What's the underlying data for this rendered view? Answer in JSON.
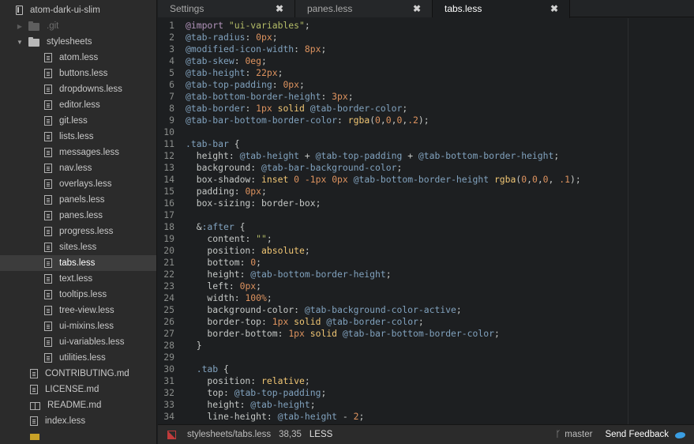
{
  "tree": {
    "root": "atom-dark-ui-slim",
    "git_folder": ".git",
    "stylesheets_folder": "stylesheets",
    "stylesheet_files": [
      "atom.less",
      "buttons.less",
      "dropdowns.less",
      "editor.less",
      "git.less",
      "lists.less",
      "messages.less",
      "nav.less",
      "overlays.less",
      "panels.less",
      "panes.less",
      "progress.less",
      "sites.less",
      "tabs.less",
      "text.less",
      "tooltips.less",
      "tree-view.less",
      "ui-mixins.less",
      "ui-variables.less",
      "utilities.less"
    ],
    "selected_file": "tabs.less",
    "root_files": [
      {
        "name": "CONTRIBUTING.md",
        "icon": "file-icon"
      },
      {
        "name": "LICENSE.md",
        "icon": "file-icon"
      },
      {
        "name": "README.md",
        "icon": "book-icon"
      },
      {
        "name": "index.less",
        "icon": "file-icon"
      }
    ]
  },
  "tabs": [
    {
      "label": "Settings",
      "active": false
    },
    {
      "label": "panes.less",
      "active": false
    },
    {
      "label": "tabs.less",
      "active": true
    }
  ],
  "tab_close_glyph": "✖",
  "editor": {
    "lines": [
      [
        [
          "kw",
          "@import "
        ],
        [
          "str",
          "\"ui-variables\""
        ],
        [
          "punc",
          ";"
        ]
      ],
      [
        [
          "var",
          "@tab-radius"
        ],
        [
          "punc",
          ": "
        ],
        [
          "num",
          "0px"
        ],
        [
          "punc",
          ";"
        ]
      ],
      [
        [
          "var",
          "@modified-icon-width"
        ],
        [
          "punc",
          ": "
        ],
        [
          "num",
          "8px"
        ],
        [
          "punc",
          ";"
        ]
      ],
      [
        [
          "var",
          "@tab-skew"
        ],
        [
          "punc",
          ": "
        ],
        [
          "num",
          "0eg"
        ],
        [
          "punc",
          ";"
        ]
      ],
      [
        [
          "var",
          "@tab-height"
        ],
        [
          "punc",
          ": "
        ],
        [
          "num",
          "22px"
        ],
        [
          "punc",
          ";"
        ]
      ],
      [
        [
          "var",
          "@tab-top-padding"
        ],
        [
          "punc",
          ": "
        ],
        [
          "num",
          "0px"
        ],
        [
          "punc",
          ";"
        ]
      ],
      [
        [
          "var",
          "@tab-bottom-border-height"
        ],
        [
          "punc",
          ": "
        ],
        [
          "num",
          "3px"
        ],
        [
          "punc",
          ";"
        ]
      ],
      [
        [
          "var",
          "@tab-border"
        ],
        [
          "punc",
          ": "
        ],
        [
          "num",
          "1px"
        ],
        [
          "punc",
          " "
        ],
        [
          "val",
          "solid"
        ],
        [
          "punc",
          " "
        ],
        [
          "var",
          "@tab-border-color"
        ],
        [
          "punc",
          ";"
        ]
      ],
      [
        [
          "var",
          "@tab-bar-bottom-border-color"
        ],
        [
          "punc",
          ": "
        ],
        [
          "val",
          "rgba"
        ],
        [
          "punc",
          "("
        ],
        [
          "num",
          "0"
        ],
        [
          "punc",
          ","
        ],
        [
          "num",
          "0"
        ],
        [
          "punc",
          ","
        ],
        [
          "num",
          "0"
        ],
        [
          "punc",
          ","
        ],
        [
          "num",
          ".2"
        ],
        [
          "punc",
          ");"
        ]
      ],
      [],
      [
        [
          "sel",
          ".tab-bar"
        ],
        [
          "punc",
          " {"
        ]
      ],
      [
        [
          "prop",
          "  height"
        ],
        [
          "punc",
          ": "
        ],
        [
          "var",
          "@tab-height"
        ],
        [
          "punc",
          " + "
        ],
        [
          "var",
          "@tab-top-padding"
        ],
        [
          "punc",
          " + "
        ],
        [
          "var",
          "@tab-bottom-border-height"
        ],
        [
          "punc",
          ";"
        ]
      ],
      [
        [
          "prop",
          "  background"
        ],
        [
          "punc",
          ": "
        ],
        [
          "var",
          "@tab-bar-background-color"
        ],
        [
          "punc",
          ";"
        ]
      ],
      [
        [
          "prop",
          "  box-shadow"
        ],
        [
          "punc",
          ": "
        ],
        [
          "val",
          "inset"
        ],
        [
          "punc",
          " "
        ],
        [
          "num",
          "0"
        ],
        [
          "punc",
          " "
        ],
        [
          "num",
          "-1px"
        ],
        [
          "punc",
          " "
        ],
        [
          "num",
          "0px"
        ],
        [
          "punc",
          " "
        ],
        [
          "var",
          "@tab-bottom-border-height"
        ],
        [
          "punc",
          " "
        ],
        [
          "val",
          "rgba"
        ],
        [
          "punc",
          "("
        ],
        [
          "num",
          "0"
        ],
        [
          "punc",
          ","
        ],
        [
          "num",
          "0"
        ],
        [
          "punc",
          ","
        ],
        [
          "num",
          "0"
        ],
        [
          "punc",
          ", "
        ],
        [
          "num",
          ".1"
        ],
        [
          "punc",
          ");"
        ]
      ],
      [
        [
          "prop",
          "  padding"
        ],
        [
          "punc",
          ": "
        ],
        [
          "num",
          "0px"
        ],
        [
          "punc",
          ";"
        ]
      ],
      [
        [
          "prop",
          "  box-sizing"
        ],
        [
          "punc",
          ": border-box;"
        ]
      ],
      [],
      [
        [
          "punc",
          "  &"
        ],
        [
          "sel",
          ":after"
        ],
        [
          "punc",
          " {"
        ]
      ],
      [
        [
          "prop",
          "    content"
        ],
        [
          "punc",
          ": "
        ],
        [
          "str",
          "\"\""
        ],
        [
          "punc",
          ";"
        ]
      ],
      [
        [
          "prop",
          "    position"
        ],
        [
          "punc",
          ": "
        ],
        [
          "val",
          "absolute"
        ],
        [
          "punc",
          ";"
        ]
      ],
      [
        [
          "prop",
          "    bottom"
        ],
        [
          "punc",
          ": "
        ],
        [
          "num",
          "0"
        ],
        [
          "punc",
          ";"
        ]
      ],
      [
        [
          "prop",
          "    height"
        ],
        [
          "punc",
          ": "
        ],
        [
          "var",
          "@tab-bottom-border-height"
        ],
        [
          "punc",
          ";"
        ]
      ],
      [
        [
          "prop",
          "    left"
        ],
        [
          "punc",
          ": "
        ],
        [
          "num",
          "0px"
        ],
        [
          "punc",
          ";"
        ]
      ],
      [
        [
          "prop",
          "    width"
        ],
        [
          "punc",
          ": "
        ],
        [
          "num",
          "100%"
        ],
        [
          "punc",
          ";"
        ]
      ],
      [
        [
          "prop",
          "    background-color"
        ],
        [
          "punc",
          ": "
        ],
        [
          "var",
          "@tab-background-color-active"
        ],
        [
          "punc",
          ";"
        ]
      ],
      [
        [
          "prop",
          "    border-top"
        ],
        [
          "punc",
          ": "
        ],
        [
          "num",
          "1px"
        ],
        [
          "punc",
          " "
        ],
        [
          "val",
          "solid"
        ],
        [
          "punc",
          " "
        ],
        [
          "var",
          "@tab-border-color"
        ],
        [
          "punc",
          ";"
        ]
      ],
      [
        [
          "prop",
          "    border-bottom"
        ],
        [
          "punc",
          ": "
        ],
        [
          "num",
          "1px"
        ],
        [
          "punc",
          " "
        ],
        [
          "val",
          "solid"
        ],
        [
          "punc",
          " "
        ],
        [
          "var",
          "@tab-bar-bottom-border-color"
        ],
        [
          "punc",
          ";"
        ]
      ],
      [
        [
          "punc",
          "  }"
        ]
      ],
      [],
      [
        [
          "sel",
          "  .tab"
        ],
        [
          "punc",
          " {"
        ]
      ],
      [
        [
          "prop",
          "    position"
        ],
        [
          "punc",
          ": "
        ],
        [
          "val",
          "relative"
        ],
        [
          "punc",
          ";"
        ]
      ],
      [
        [
          "prop",
          "    top"
        ],
        [
          "punc",
          ": "
        ],
        [
          "var",
          "@tab-top-padding"
        ],
        [
          "punc",
          ";"
        ]
      ],
      [
        [
          "prop",
          "    height"
        ],
        [
          "punc",
          ": "
        ],
        [
          "var",
          "@tab-height"
        ],
        [
          "punc",
          ";"
        ]
      ],
      [
        [
          "prop",
          "    line-height"
        ],
        [
          "punc",
          ": "
        ],
        [
          "var",
          "@tab-height"
        ],
        [
          "punc",
          " - "
        ],
        [
          "num",
          "2"
        ],
        [
          "punc",
          ";"
        ]
      ]
    ]
  },
  "status": {
    "path": "stylesheets/tabs.less",
    "cursor": "38,35",
    "grammar": "LESS",
    "branch": "master",
    "feedback": "Send Feedback"
  },
  "colors": {
    "tree_bg": "#2b2b2b",
    "editor_bg": "#1d1f21",
    "selected_row": "#3c3c3c",
    "accent_blue": "#3a9ee3"
  }
}
